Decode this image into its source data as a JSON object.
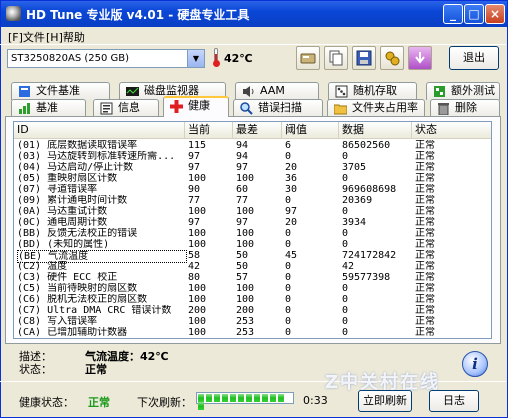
{
  "window": {
    "title": "HD Tune 专业版 v4.01 - 硬盘专业工具",
    "minimize": "_",
    "maximize": "□",
    "close": "×"
  },
  "menu": [
    "[F]文件",
    "[H]帮助"
  ],
  "toolbar": {
    "drive": "ST3250820AS (250 GB)",
    "temperature": "42℃",
    "exit_label": "退出",
    "buttons": [
      "info-icon",
      "copy-icon",
      "save-icon",
      "options-icon",
      "download-icon"
    ]
  },
  "tabs_row1": [
    {
      "label": "文件基准",
      "icon": "file-benchmark-icon"
    },
    {
      "label": "磁盘监视器",
      "icon": "disk-monitor-icon"
    },
    {
      "label": "AAM",
      "icon": "speaker-icon"
    },
    {
      "label": "随机存取",
      "icon": "random-access-icon"
    },
    {
      "label": "额外测试",
      "icon": "extra-tests-icon"
    }
  ],
  "tabs_row2": [
    {
      "label": "基准",
      "icon": "benchmark-icon"
    },
    {
      "label": "信息",
      "icon": "info-icon"
    },
    {
      "label": "健康",
      "icon": "health-cross-icon"
    },
    {
      "label": "错误扫描",
      "icon": "error-scan-icon"
    },
    {
      "label": "文件夹占用率",
      "icon": "folder-usage-icon"
    },
    {
      "label": "删除",
      "icon": "erase-icon"
    }
  ],
  "table": {
    "headers": [
      "ID",
      "当前",
      "最差",
      "阈值",
      "数据",
      "状态"
    ],
    "rows": [
      [
        "(01) 底层数据读取错误率",
        "115",
        "94",
        "6",
        "86502560",
        "正常"
      ],
      [
        "(03) 马达旋转到标准转速所需...",
        "97",
        "94",
        "0",
        "0",
        "正常"
      ],
      [
        "(04) 马达启动/停止计数",
        "97",
        "97",
        "20",
        "3705",
        "正常"
      ],
      [
        "(05) 重映射扇区计数",
        "100",
        "100",
        "36",
        "0",
        "正常"
      ],
      [
        "(07) 寻道错误率",
        "90",
        "60",
        "30",
        "969608698",
        "正常"
      ],
      [
        "(09) 累计通电时间计数",
        "77",
        "77",
        "0",
        "20369",
        "正常"
      ],
      [
        "(0A) 马达重试计数",
        "100",
        "100",
        "97",
        "0",
        "正常"
      ],
      [
        "(0C) 通电周期计数",
        "97",
        "97",
        "20",
        "3934",
        "正常"
      ],
      [
        "(BB) 反馈无法校正的错误",
        "100",
        "100",
        "0",
        "0",
        "正常"
      ],
      [
        "(BD) (未知的属性)",
        "100",
        "100",
        "0",
        "0",
        "正常"
      ],
      [
        "(BE) 气流温度",
        "58",
        "50",
        "45",
        "724172842",
        "正常"
      ],
      [
        "(C2) 温度",
        "42",
        "50",
        "0",
        "42",
        "正常"
      ],
      [
        "(C3) 硬件 ECC 校正",
        "80",
        "57",
        "0",
        "59577398",
        "正常"
      ],
      [
        "(C5) 当前待映射的扇区数",
        "100",
        "100",
        "0",
        "0",
        "正常"
      ],
      [
        "(C6) 脱机无法校正的扇区数",
        "100",
        "100",
        "0",
        "0",
        "正常"
      ],
      [
        "(C7) Ultra DMA CRC 错误计数",
        "200",
        "200",
        "0",
        "0",
        "正常"
      ],
      [
        "(C8) 写入错误率",
        "100",
        "253",
        "0",
        "0",
        "正常"
      ],
      [
        "(CA) 已增加辅助计数器",
        "100",
        "253",
        "0",
        "0",
        "正常"
      ]
    ]
  },
  "details": {
    "desc_label": "描述：",
    "desc_value": "气流温度：42℃",
    "status_label": "状态：",
    "status_value": "正常"
  },
  "statusbar": {
    "health_label": "健康状态：",
    "health_value": "正常",
    "next_refresh_label": "下次刷新：",
    "progress": 1.0,
    "timer": "0:33",
    "refresh_label": "立即刷新",
    "log_label": "日志"
  },
  "watermark": "Z中关村在线"
}
